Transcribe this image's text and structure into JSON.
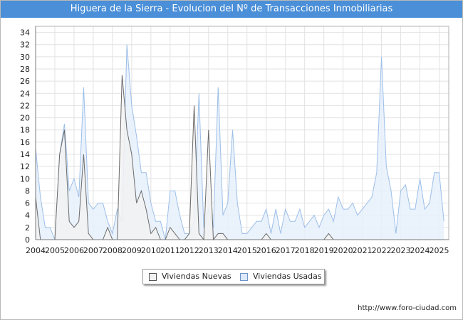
{
  "title": "Higuera de la Sierra - Evolucion del Nº de Transacciones Inmobiliarias",
  "source": "http://www.foro-ciudad.com",
  "colors": {
    "title_bg": "#4a8fd8",
    "nuevas_line": "#6b6b6b",
    "nuevas_fill": "#f2f2f2",
    "usadas_line": "#9dbfe8",
    "usadas_fill": "#e6f0fb",
    "grid": "#e2e2e2"
  },
  "legend": [
    {
      "name": "Viviendas Nuevas",
      "color": "#f2f2f2",
      "border": "#555555"
    },
    {
      "name": "Viviendas Usadas",
      "color": "#dbe9fa",
      "border": "#6e94c8"
    }
  ],
  "chart_data": {
    "type": "area",
    "title": "Higuera de la Sierra - Evolucion del Nº de Transacciones Inmobiliarias",
    "x_unit": "quarter",
    "x_start": "2004-Q1",
    "x_ticks": [
      "2004",
      "2005",
      "2006",
      "2007",
      "2008",
      "2009",
      "2010",
      "2011",
      "2012",
      "2013",
      "2014",
      "2015",
      "2016",
      "2017",
      "2018",
      "2019",
      "2020",
      "2021",
      "2022",
      "2023",
      "2024",
      "2025"
    ],
    "y_ticks": [
      0,
      2,
      4,
      6,
      8,
      10,
      12,
      14,
      16,
      18,
      20,
      22,
      24,
      26,
      28,
      30,
      32,
      34
    ],
    "ylim": [
      0,
      35
    ],
    "grid": true,
    "legend_position": "bottom",
    "series": [
      {
        "name": "Viviendas Nuevas",
        "values": [
          7,
          0,
          0,
          0,
          0,
          14,
          18,
          3,
          2,
          3,
          14,
          1,
          0,
          0,
          0,
          2,
          0,
          0,
          27,
          18,
          14,
          6,
          8,
          5,
          1,
          2,
          0,
          0,
          2,
          1,
          0,
          0,
          1,
          22,
          1,
          0,
          18,
          0,
          1,
          1,
          0,
          0,
          0,
          0,
          0,
          0,
          0,
          0,
          1,
          0,
          0,
          0,
          0,
          0,
          0,
          0,
          0,
          0,
          0,
          0,
          0,
          1,
          0,
          0,
          0,
          0,
          0,
          0,
          0,
          0,
          0,
          0,
          0,
          0,
          0,
          0,
          0,
          0,
          0,
          0,
          0,
          0,
          0,
          0,
          0,
          0,
          0
        ]
      },
      {
        "name": "Viviendas Usadas",
        "values": [
          15,
          7,
          2,
          2,
          0,
          14,
          19,
          8,
          10,
          7,
          25,
          6,
          5,
          6,
          6,
          3,
          1,
          5,
          3,
          32,
          22,
          17,
          11,
          11,
          6,
          3,
          3,
          0,
          8,
          8,
          4,
          1,
          1,
          3,
          24,
          2,
          5,
          2,
          25,
          4,
          6,
          18,
          6,
          1,
          1,
          2,
          3,
          3,
          5,
          1,
          5,
          1,
          5,
          3,
          3,
          5,
          2,
          3,
          4,
          2,
          4,
          5,
          3,
          7,
          5,
          5,
          6,
          4,
          5,
          6,
          7,
          11,
          30,
          12,
          8,
          1,
          8,
          9,
          5,
          5,
          10,
          5,
          6,
          11,
          11,
          3
        ]
      }
    ]
  }
}
